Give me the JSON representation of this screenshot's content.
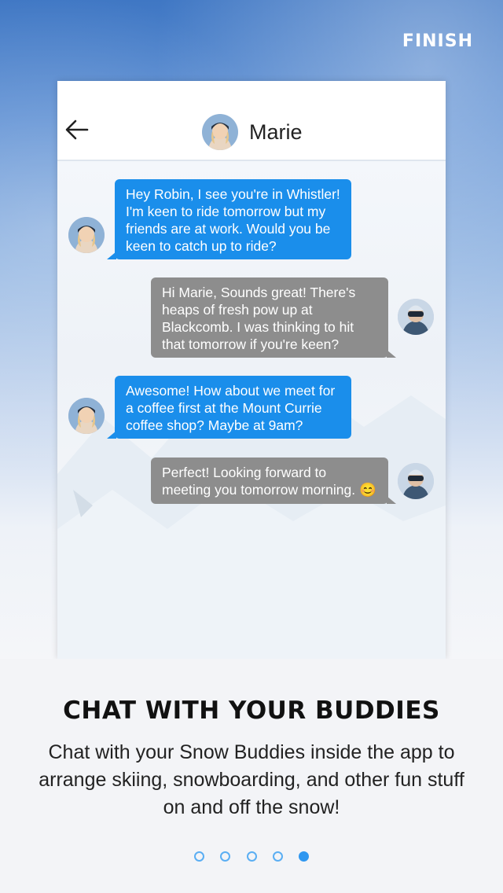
{
  "header": {
    "finish_label": "FINISH"
  },
  "chat": {
    "contact_name": "Marie",
    "messages": [
      {
        "from": "Marie",
        "side": "left",
        "text": "Hey Robin, I see you're in Whistler! I'm keen to ride tomorrow but my friends are at work. Would you be keen to catch up to ride?"
      },
      {
        "from": "Robin",
        "side": "right",
        "text": "Hi Marie, Sounds great! There's heaps of fresh pow up at Blackcomb. I was thinking to hit that tomorrow if you're keen?"
      },
      {
        "from": "Marie",
        "side": "left",
        "text": "Awesome! How about we meet for a coffee first at the Mount Currie coffee shop? Maybe at 9am?"
      },
      {
        "from": "Robin",
        "side": "right",
        "text": "Perfect! Looking forward to meeting you tomorrow morning. 😊"
      }
    ]
  },
  "onboarding": {
    "title": "CHAT WITH YOUR BUDDIES",
    "description": "Chat with your Snow Buddies inside the app to arrange skiing, snowboarding, and other fun stuff on and off the snow!",
    "page_count": 5,
    "active_page": 5
  },
  "colors": {
    "accent_blue": "#1a8eeb",
    "grey_bubble": "#8d8d8d",
    "dot_blue": "#2f97f0"
  },
  "icons": {
    "back": "arrow-left-icon",
    "page_dot": "dot-icon"
  }
}
